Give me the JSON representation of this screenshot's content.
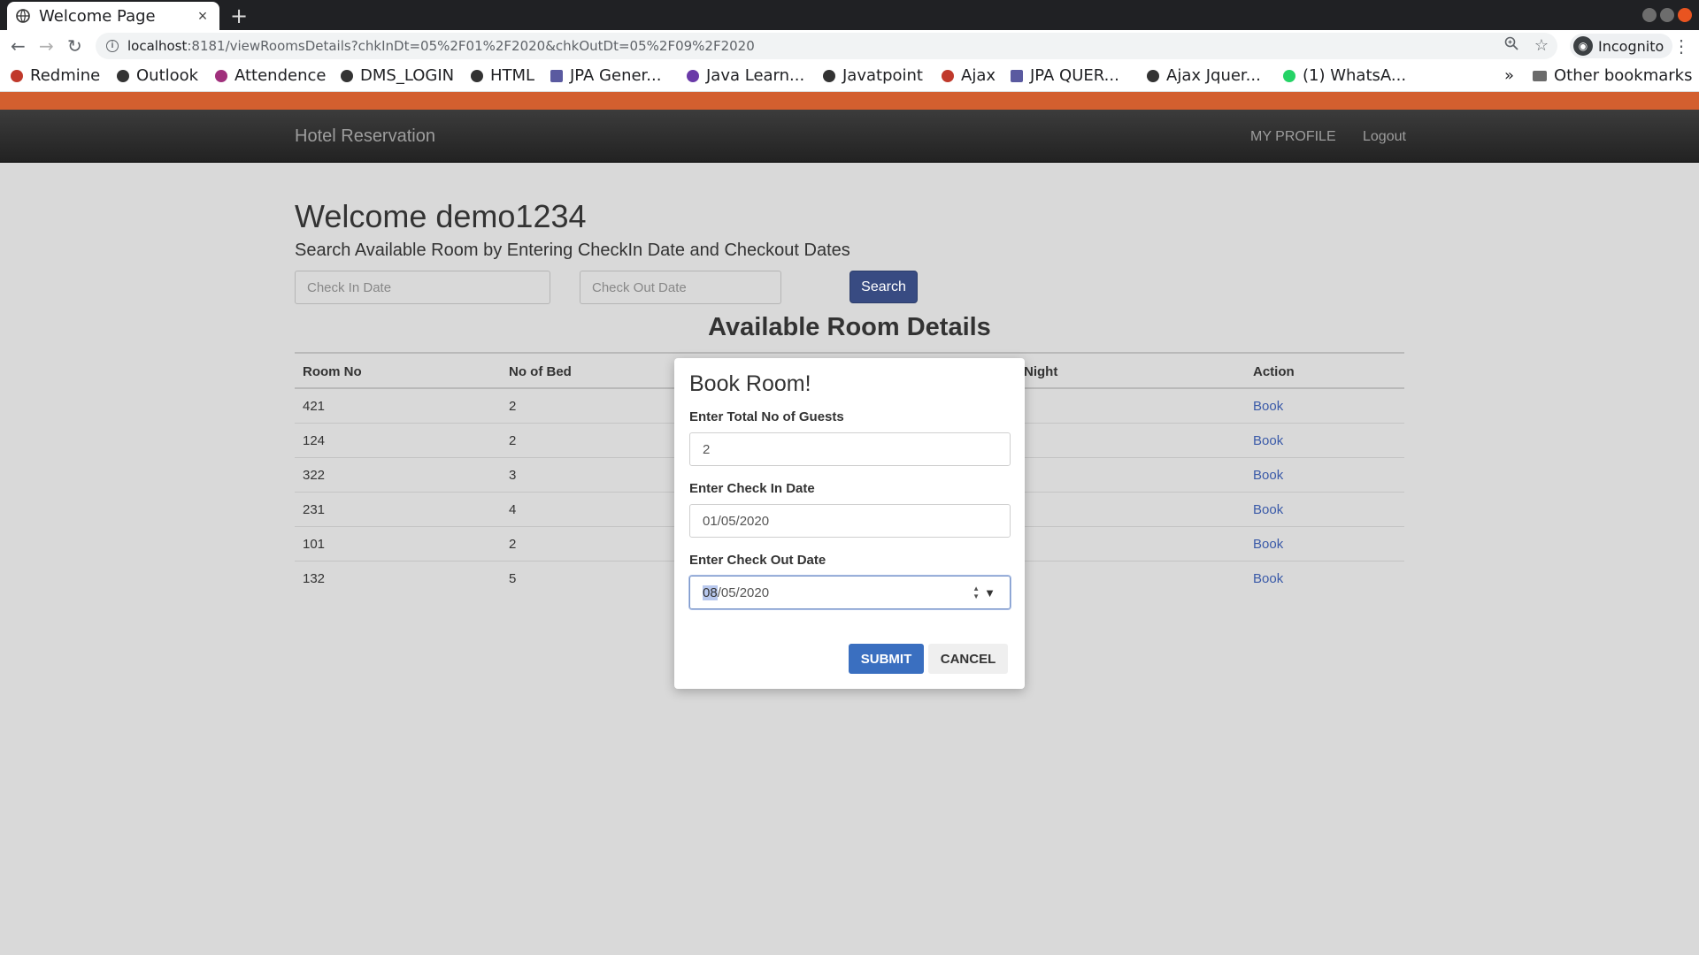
{
  "browser": {
    "tab_title": "Welcome Page",
    "tab_close": "×",
    "new_tab": "+",
    "url_host": "localhost",
    "url_rest": ":8181/viewRoomsDetails?chkInDt=05%2F01%2F2020&chkOutDt=05%2F09%2F2020",
    "profile_label": "Incognito",
    "bookmarks": [
      {
        "label": "Redmine",
        "color": "#c0392b"
      },
      {
        "label": "Outlook",
        "color": "#333333"
      },
      {
        "label": "Attendence",
        "color": "#a0307c"
      },
      {
        "label": "DMS_LOGIN",
        "color": "#333333"
      },
      {
        "label": "HTML",
        "color": "#333333"
      },
      {
        "label": "JPA Gener...",
        "color": "#5a5aa0"
      },
      {
        "label": "Java Learn...",
        "color": "#6a3aa8"
      },
      {
        "label": "Javatpoint",
        "color": "#333333"
      },
      {
        "label": "Ajax",
        "color": "#c0392b"
      },
      {
        "label": "JPA QUER...",
        "color": "#5a5aa0"
      },
      {
        "label": "Ajax Jquer...",
        "color": "#333333"
      },
      {
        "label": "(1) WhatsA...",
        "color": "#25d366"
      }
    ],
    "overflow": "»",
    "other_bookmarks": "Other bookmarks"
  },
  "navbar": {
    "brand": "Hotel Reservation",
    "my_profile": "MY PROFILE",
    "logout": "Logout"
  },
  "page": {
    "welcome": "Welcome demo1234",
    "subtitle": "Search Available Room by Entering CheckIn Date and Checkout Dates",
    "checkin_placeholder": "Check In Date",
    "checkout_placeholder": "Check Out Date",
    "search_label": "Search",
    "available_title": "Available Room Details"
  },
  "table": {
    "headers": [
      "Room No",
      "No of Bed",
      "Night",
      "Action"
    ],
    "rows": [
      {
        "room": "421",
        "beds": "2",
        "action": "Book"
      },
      {
        "room": "124",
        "beds": "2",
        "action": "Book"
      },
      {
        "room": "322",
        "beds": "3",
        "action": "Book"
      },
      {
        "room": "231",
        "beds": "4",
        "action": "Book"
      },
      {
        "room": "101",
        "beds": "2",
        "action": "Book"
      },
      {
        "room": "132",
        "beds": "5",
        "action": "Book"
      }
    ]
  },
  "modal": {
    "title": "Book Room!",
    "guests_label": "Enter Total No of Guests",
    "guests_value": "2",
    "checkin_label": "Enter Check In Date",
    "checkin_value": "01/05/2020",
    "checkout_label": "Enter Check Out Date",
    "checkout_value_selected": "08",
    "checkout_value_rest": "/05/2020",
    "submit": "SUBMIT",
    "cancel": "CANCEL"
  },
  "colors": {
    "accent_orange": "#d35f2f",
    "search_button": "#384b82",
    "submit_button": "#3a6fc0",
    "link_blue": "#3a5aa8"
  }
}
